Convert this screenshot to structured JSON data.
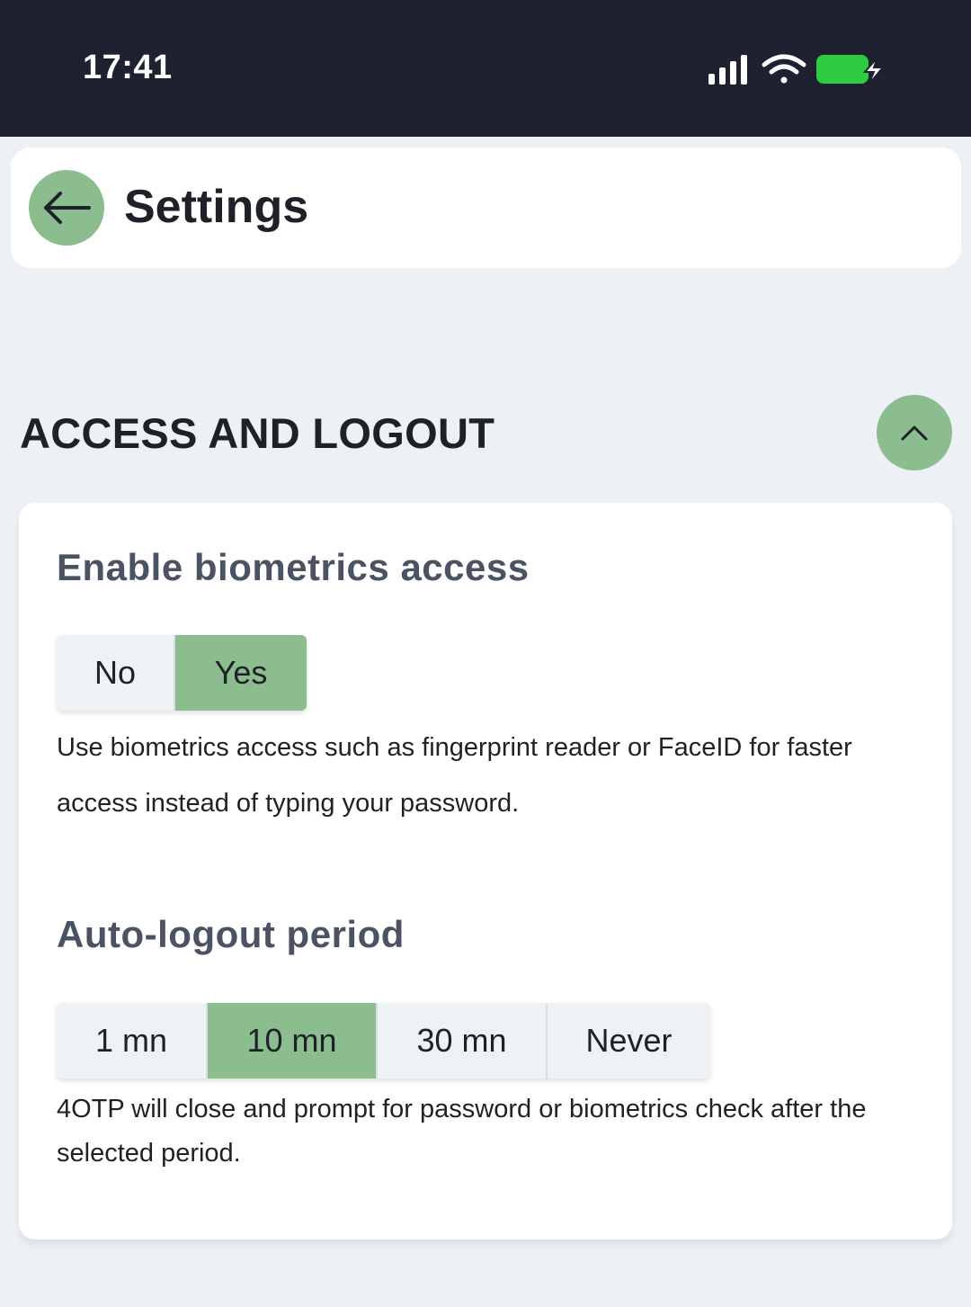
{
  "status_bar": {
    "time": "17:41",
    "icons": [
      "signal-icon",
      "wifi-icon",
      "battery-charging-icon"
    ],
    "battery_color": "#2ecc40"
  },
  "header": {
    "back_icon": "arrow-left-icon",
    "title": "Settings"
  },
  "section": {
    "title": "ACCESS AND LOGOUT",
    "collapse_icon": "chevron-up-icon"
  },
  "biometrics": {
    "title": "Enable biometrics access",
    "options": [
      "No",
      "Yes"
    ],
    "selected": "Yes",
    "description": "Use biometrics access such as fingerprint reader or FaceID for faster access instead of typing your password."
  },
  "auto_logout": {
    "title": "Auto-logout period",
    "options": [
      "1 mn",
      "10 mn",
      "30 mn",
      "Never"
    ],
    "selected": "10 mn",
    "description": "4OTP will close and prompt for password or biometrics check after the selected period."
  },
  "colors": {
    "accent": "#8bbd8f",
    "status_bar_bg": "#1d2130",
    "page_bg": "#edf1f6"
  }
}
